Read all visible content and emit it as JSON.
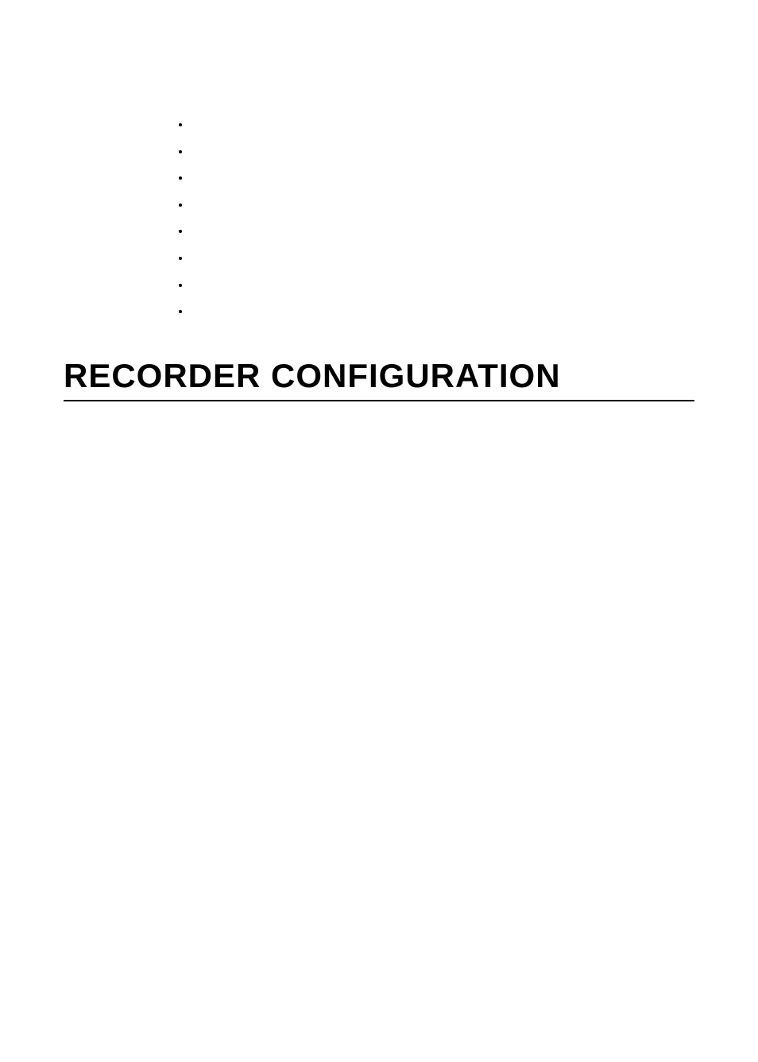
{
  "heading": "RECORDER CONFIGURATION"
}
